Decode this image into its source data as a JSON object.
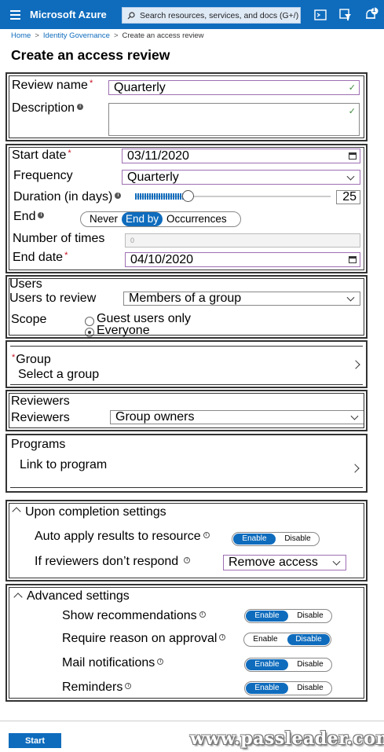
{
  "header": {
    "brand": "Microsoft Azure",
    "search_placeholder": "Search resources, services, and docs (G+/)",
    "notification_count": "1"
  },
  "breadcrumb": [
    "Home",
    "Identity Governance",
    "Create an access review"
  ],
  "page_title": "Create an access review",
  "basics": {
    "review_name_label": "Review name",
    "review_name_value": "Quarterly",
    "description_label": "Description",
    "description_value": ""
  },
  "schedule": {
    "start_date_label": "Start date",
    "start_date_value": "03/11/2020",
    "frequency_label": "Frequency",
    "frequency_value": "Quarterly",
    "duration_label": "Duration (in days)",
    "duration_value": "25",
    "duration_fraction": 0.27,
    "end_label": "End",
    "end_options": [
      "Never",
      "End by",
      "Occurrences"
    ],
    "end_selected": "End by",
    "number_of_times_label": "Number of times",
    "number_of_times_value": "0",
    "end_date_label": "End date",
    "end_date_value": "04/10/2020"
  },
  "users": {
    "section_title": "Users",
    "users_to_review_label": "Users to review",
    "users_to_review_value": "Members of a group",
    "scope_label": "Scope",
    "scope_options": [
      "Guest users only",
      "Everyone"
    ],
    "scope_selected": "Everyone"
  },
  "group": {
    "label": "Group",
    "link": "Select a group"
  },
  "reviewers": {
    "section_title": "Reviewers",
    "label": "Reviewers",
    "value": "Group owners"
  },
  "programs": {
    "section_title": "Programs",
    "link": "Link to program"
  },
  "completion": {
    "title": "Upon completion settings",
    "auto_apply_label": "Auto apply results to resource",
    "auto_apply_value": "Enable",
    "no_response_label": "If reviewers don’t respond",
    "no_response_value": "Remove access"
  },
  "advanced": {
    "title": "Advanced settings",
    "rows": [
      {
        "label": "Show recommendations",
        "value": "Enable"
      },
      {
        "label": "Require reason on approval",
        "value": "Disable"
      },
      {
        "label": "Mail notifications",
        "value": "Enable"
      },
      {
        "label": "Reminders",
        "value": "Enable"
      }
    ],
    "enable_text": "Enable",
    "disable_text": "Disable"
  },
  "footer": {
    "start_label": "Start"
  },
  "watermark": "www.passleader.com",
  "colors": {
    "azure_blue": "#0f6cbd",
    "focus_border": "#9e6fb3",
    "required": "#c50f1f"
  }
}
